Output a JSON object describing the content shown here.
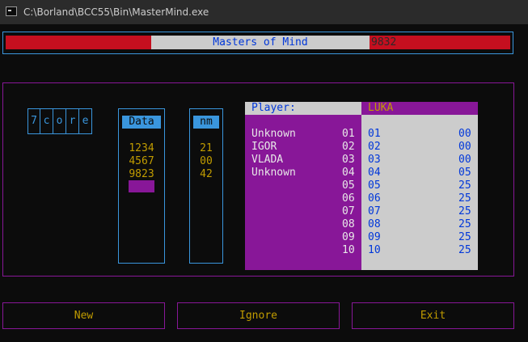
{
  "window": {
    "title": "C:\\Borland\\BCC55\\Bin\\MasterMind.exe"
  },
  "header": {
    "title": "Masters of Mind",
    "score": "9832"
  },
  "code": {
    "chars": [
      "7",
      "c",
      "o",
      "r",
      "e"
    ]
  },
  "data_column": {
    "header": "Data",
    "values": [
      "1234",
      "4567",
      "9823"
    ]
  },
  "nm_column": {
    "header": "nm",
    "values": [
      "21",
      "00",
      "42"
    ]
  },
  "players": {
    "label": "Player:",
    "current": "LUKA",
    "rows": [
      {
        "name": "Unknown",
        "rank": "01",
        "index": "01",
        "score": "00"
      },
      {
        "name": "IGOR",
        "rank": "02",
        "index": "02",
        "score": "00"
      },
      {
        "name": "VLADA",
        "rank": "03",
        "index": "03",
        "score": "00"
      },
      {
        "name": "Unknown",
        "rank": "04",
        "index": "04",
        "score": "05"
      },
      {
        "name": "",
        "rank": "05",
        "index": "05",
        "score": "25"
      },
      {
        "name": "",
        "rank": "06",
        "index": "06",
        "score": "25"
      },
      {
        "name": "",
        "rank": "07",
        "index": "07",
        "score": "25"
      },
      {
        "name": "",
        "rank": "08",
        "index": "08",
        "score": "25"
      },
      {
        "name": "",
        "rank": "09",
        "index": "09",
        "score": "25"
      },
      {
        "name": "",
        "rank": "10",
        "index": "10",
        "score": "25"
      }
    ]
  },
  "buttons": {
    "new": "New",
    "ignore": "Ignore",
    "exit": "Exit"
  },
  "colors": {
    "background": "#0c0c0c",
    "accent_blue": "#3a96dd",
    "magenta": "#881798",
    "red": "#c50f1f",
    "gold": "#c19c00",
    "gray": "#cccccc",
    "dark_blue": "#0037da"
  }
}
